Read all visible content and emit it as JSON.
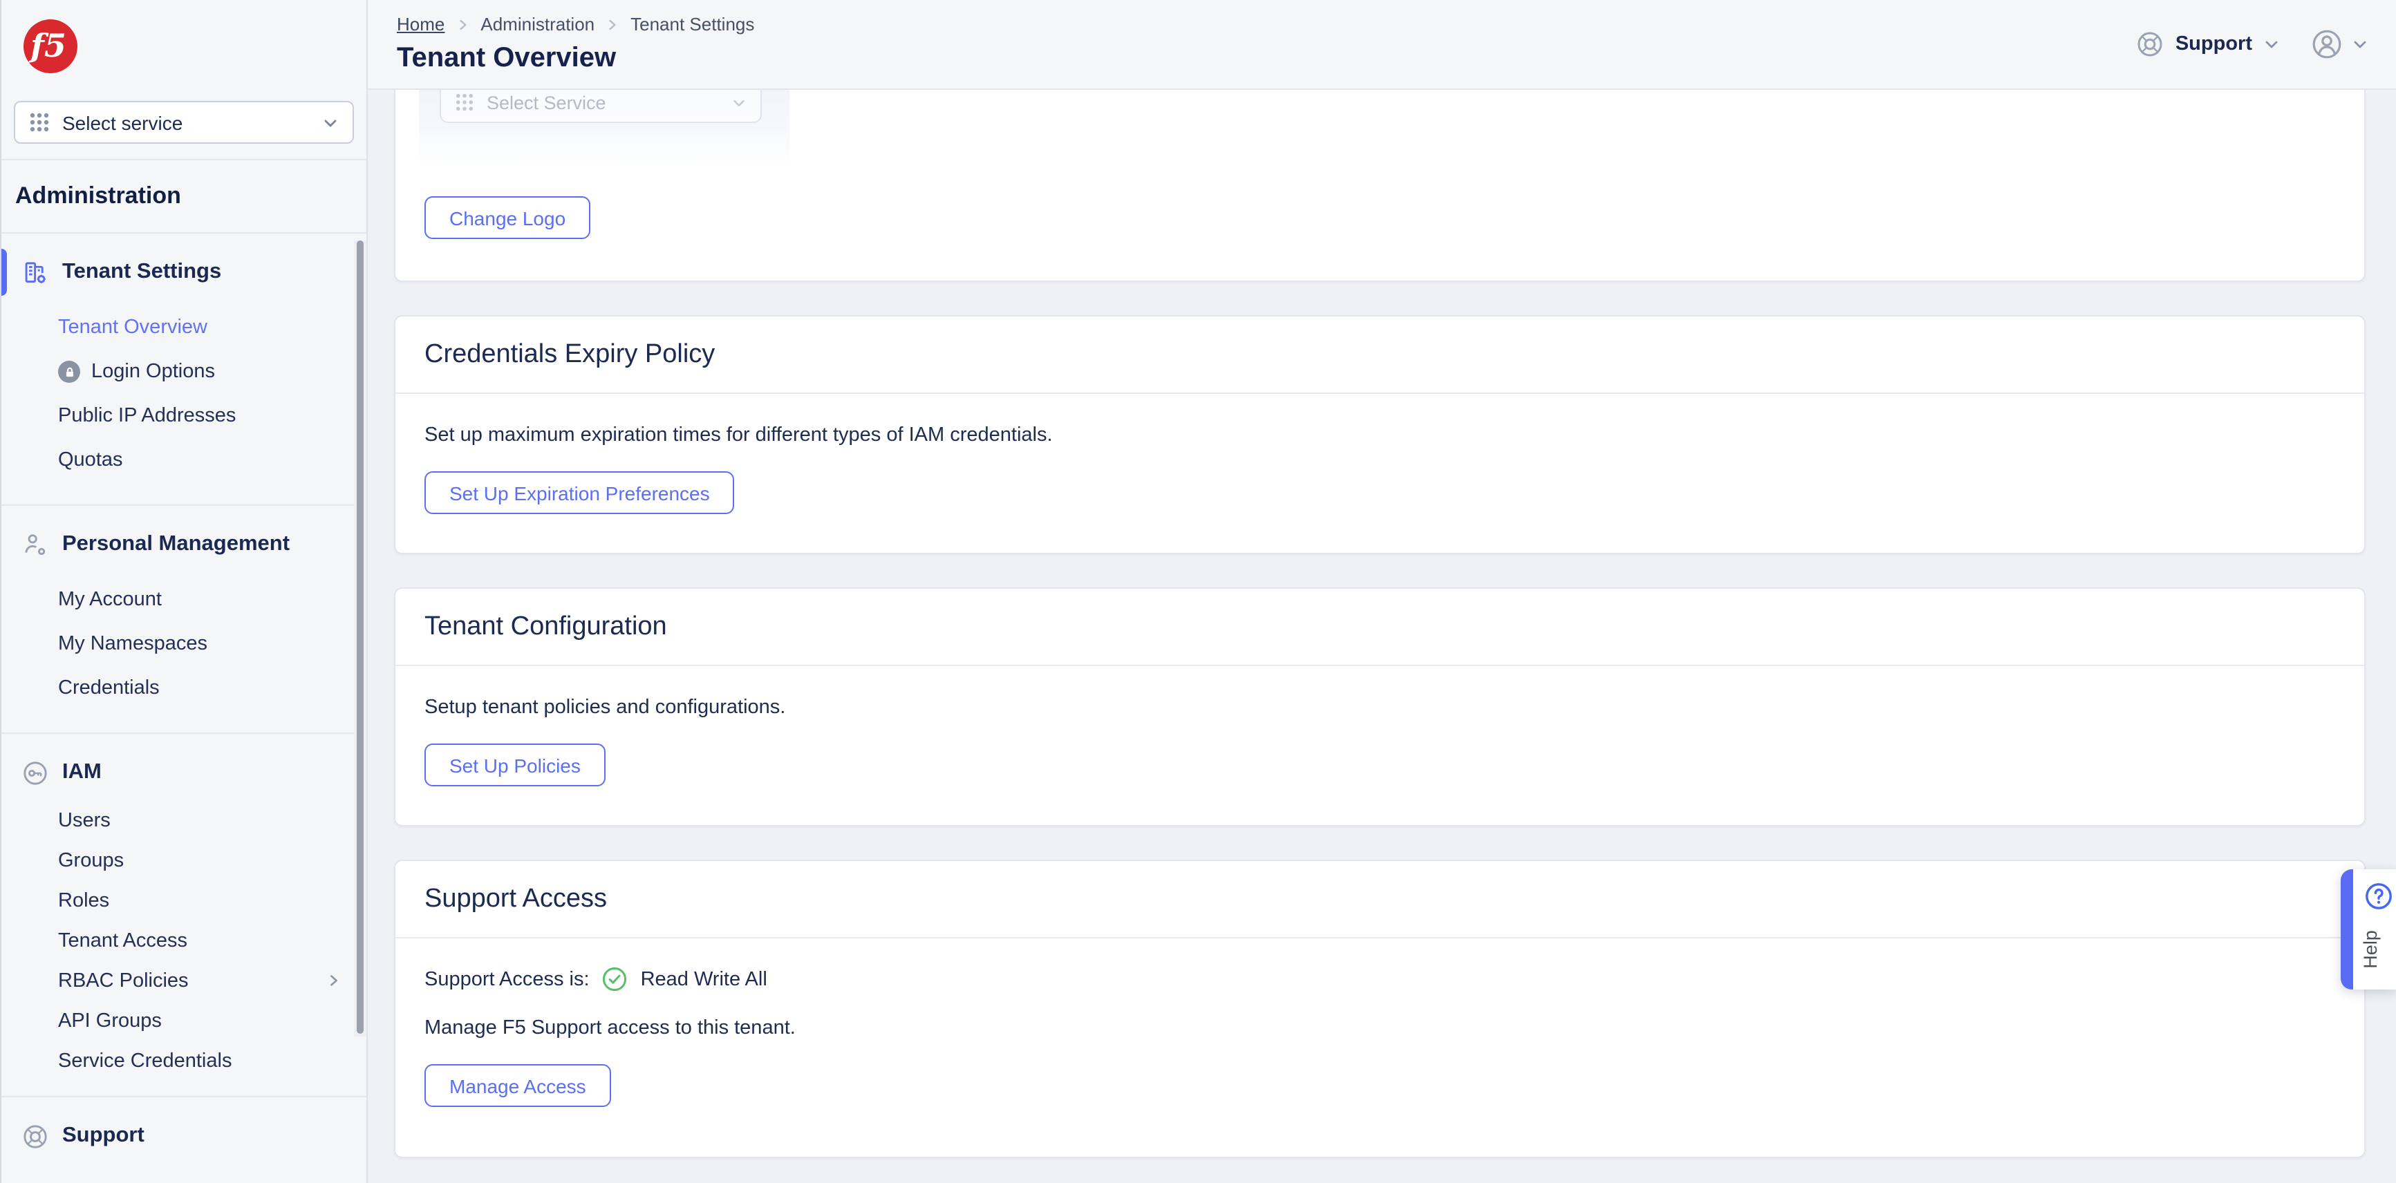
{
  "brand": {
    "logo_text": "f5"
  },
  "service_selector": {
    "label": "Select service"
  },
  "sidebar": {
    "heading": "Administration",
    "sections": [
      {
        "title": "Tenant Settings",
        "items": [
          {
            "label": "Tenant Overview"
          },
          {
            "label": "Login Options"
          },
          {
            "label": "Public IP Addresses"
          },
          {
            "label": "Quotas"
          }
        ]
      },
      {
        "title": "Personal Management",
        "items": [
          {
            "label": "My Account"
          },
          {
            "label": "My Namespaces"
          },
          {
            "label": "Credentials"
          }
        ]
      },
      {
        "title": "IAM",
        "items": [
          {
            "label": "Users"
          },
          {
            "label": "Groups"
          },
          {
            "label": "Roles"
          },
          {
            "label": "Tenant Access"
          },
          {
            "label": "RBAC Policies"
          },
          {
            "label": "API Groups"
          },
          {
            "label": "Service Credentials"
          }
        ]
      },
      {
        "title": "Support",
        "items": []
      }
    ]
  },
  "header": {
    "breadcrumb": [
      "Home",
      "Administration",
      "Tenant Settings"
    ],
    "title": "Tenant Overview",
    "support_label": "Support"
  },
  "cards": {
    "logo": {
      "preview_label": "Select Service",
      "button": "Change Logo"
    },
    "credentials_expiry": {
      "title": "Credentials Expiry Policy",
      "description": "Set up maximum expiration times for different types of IAM credentials.",
      "button": "Set Up Expiration Preferences"
    },
    "tenant_config": {
      "title": "Tenant Configuration",
      "description": "Setup tenant policies and configurations.",
      "button": "Set Up Policies"
    },
    "support_access": {
      "title": "Support Access",
      "status_label": "Support Access is:",
      "status_value": "Read Write All",
      "description": "Manage F5 Support access to this tenant.",
      "button": "Manage Access"
    }
  },
  "help_tab": {
    "label": "Help"
  },
  "colors": {
    "accent": "#5a6cf4",
    "brand_red": "#d9292f",
    "success_green": "#57c163",
    "navy": "#1b2850"
  }
}
